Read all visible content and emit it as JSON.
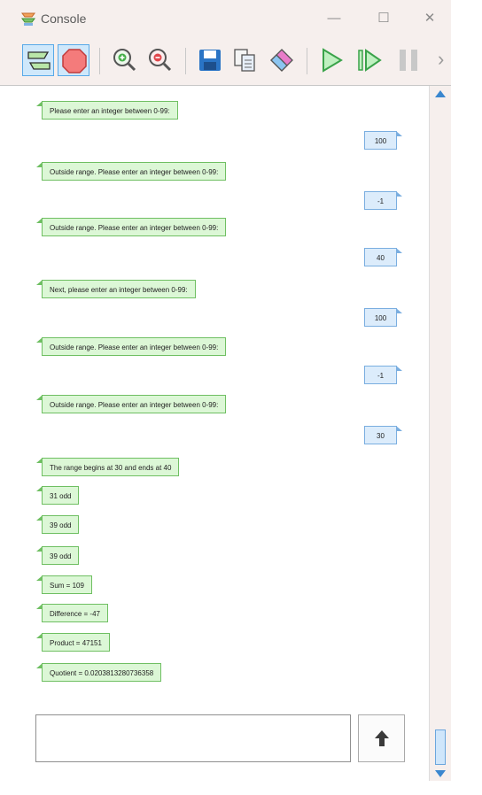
{
  "window": {
    "title": "Console",
    "minimize": "—",
    "maximize": "☐",
    "close": "✕"
  },
  "toolbar": {
    "buttons": [
      "flow-icon",
      "stop-icon",
      "zoom-in-icon",
      "zoom-out-icon",
      "save-icon",
      "copy-icon",
      "eraser-icon",
      "run-icon",
      "step-icon",
      "pause-icon"
    ],
    "overflow": "›"
  },
  "console": {
    "messages": [
      {
        "type": "out",
        "text": "Please enter an integer between 0-99:"
      },
      {
        "type": "in",
        "text": "100"
      },
      {
        "type": "out",
        "text": "Outside range. Please enter an integer between 0-99:"
      },
      {
        "type": "in",
        "text": "-1"
      },
      {
        "type": "out",
        "text": "Outside range. Please enter an integer between 0-99:"
      },
      {
        "type": "in",
        "text": "40"
      },
      {
        "type": "out",
        "text": "Next, please enter an integer between 0-99:"
      },
      {
        "type": "in",
        "text": "100"
      },
      {
        "type": "out",
        "text": "Outside range. Please enter an integer between 0-99:"
      },
      {
        "type": "in",
        "text": "-1"
      },
      {
        "type": "out",
        "text": "Outside range. Please enter an integer between 0-99:"
      },
      {
        "type": "in",
        "text": "30"
      },
      {
        "type": "out",
        "text": "The range begins at 30 and ends at 40"
      },
      {
        "type": "out",
        "text": "31 odd"
      },
      {
        "type": "out",
        "text": "39 odd"
      },
      {
        "type": "out",
        "text": "39 odd"
      },
      {
        "type": "out",
        "text": "Sum = 109"
      },
      {
        "type": "out",
        "text": "Difference = -47"
      },
      {
        "type": "out",
        "text": "Product = 47151"
      },
      {
        "type": "out",
        "text": "Quotient = 0.020381328073635 8"
      }
    ]
  },
  "input": {
    "value": "",
    "send_icon": "arrow-up-icon"
  },
  "colors": {
    "chrome": "#f6efed",
    "output_bubble": "#dcf7d6",
    "input_bubble": "#dcecfb",
    "accent": "#3a87cf"
  }
}
